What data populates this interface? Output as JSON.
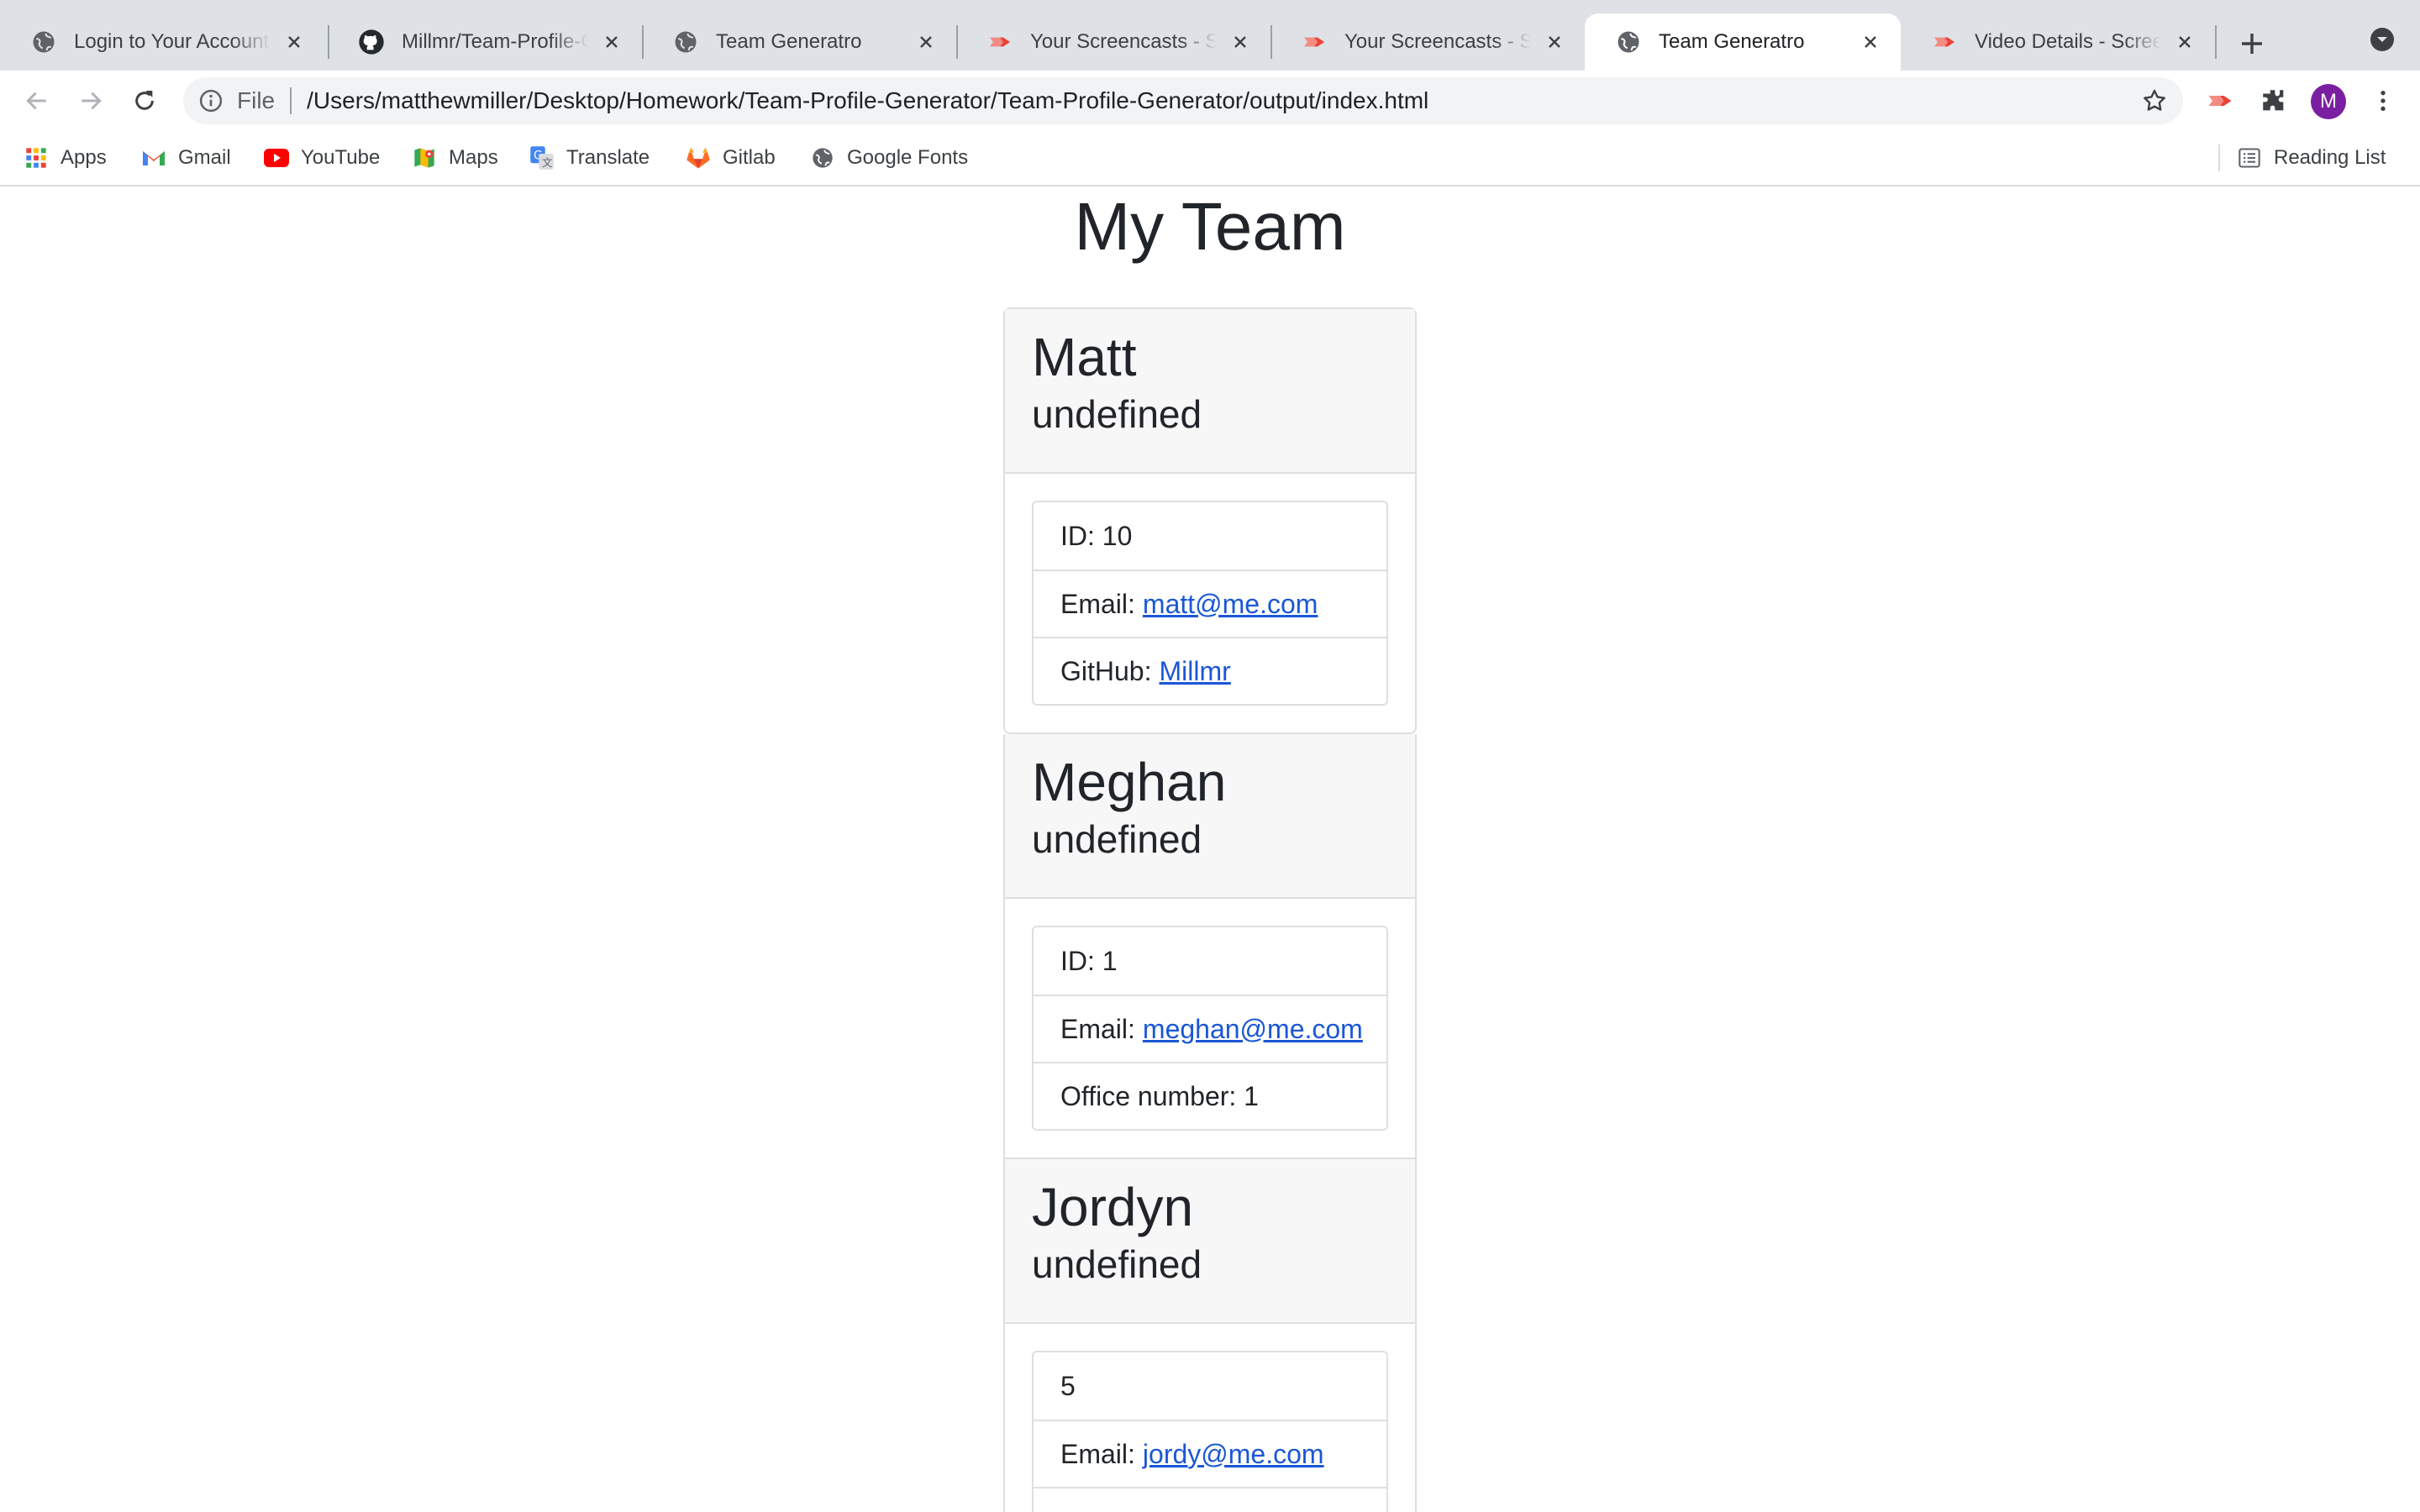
{
  "browser": {
    "tabs": [
      {
        "title": "Login to Your Account",
        "icon": "globe-icon",
        "active": false
      },
      {
        "title": "Millmr/Team-Profile-Generator",
        "icon": "github-icon",
        "active": false
      },
      {
        "title": "Team Generatro",
        "icon": "globe-icon",
        "active": false
      },
      {
        "title": "Your Screencasts - Screencastify",
        "icon": "screencastify-icon",
        "active": false
      },
      {
        "title": "Your Screencasts - Screencastify",
        "icon": "screencastify-icon",
        "active": false
      },
      {
        "title": "Team Generatro",
        "icon": "globe-icon",
        "active": true
      },
      {
        "title": "Video Details - Screencastify",
        "icon": "screencastify-icon",
        "active": false
      }
    ],
    "address": {
      "scheme": "File",
      "url": "/Users/matthewmiller/Desktop/Homework/Team-Profile-Generator/Team-Profile-Generator/output/index.html"
    },
    "profile_initial": "M",
    "bookmarks": [
      {
        "label": "Apps",
        "icon": "apps-grid-icon"
      },
      {
        "label": "Gmail",
        "icon": "gmail-icon"
      },
      {
        "label": "YouTube",
        "icon": "youtube-icon"
      },
      {
        "label": "Maps",
        "icon": "maps-icon"
      },
      {
        "label": "Translate",
        "icon": "translate-icon"
      },
      {
        "label": "Gitlab",
        "icon": "gitlab-icon"
      },
      {
        "label": "Google Fonts",
        "icon": "globe-icon"
      }
    ],
    "reading_list": "Reading List",
    "colors": {
      "tabstrip": "#dee1e6",
      "accent_link": "#1a57d6",
      "avatar": "#7b1fa2"
    }
  },
  "page": {
    "title": "My Team",
    "members": [
      {
        "name": "Matt",
        "role": "undefined",
        "id_text": "ID: 10",
        "email_label": "Email:",
        "email": "matt@me.com",
        "extra_label": "GitHub:",
        "extra_link": "Millmr"
      },
      {
        "name": "Meghan",
        "role": "undefined",
        "id_text": "ID: 1",
        "email_label": "Email:",
        "email": "meghan@me.com",
        "extra_text": "Office number: 1"
      },
      {
        "name": "Jordyn",
        "role": "undefined",
        "id_text": "5",
        "email_label": "Email:",
        "email": "jordy@me.com"
      }
    ]
  }
}
